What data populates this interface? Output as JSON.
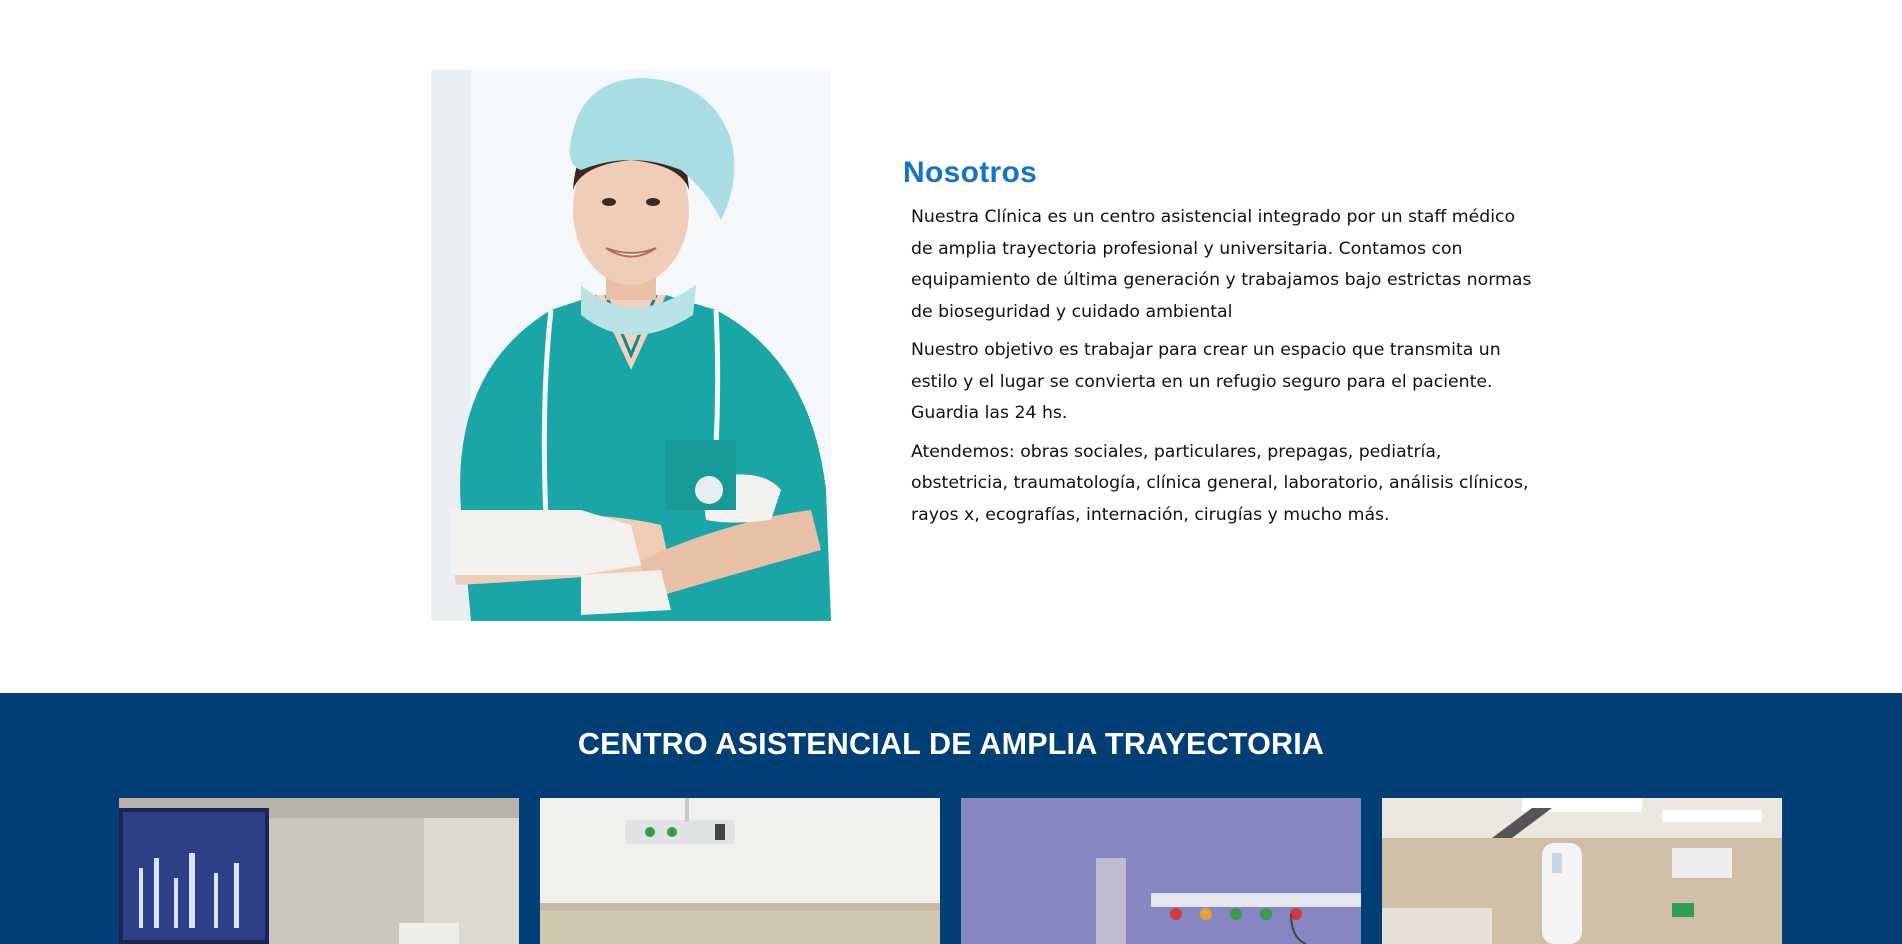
{
  "about": {
    "title": "Nosotros",
    "paragraphs": [
      "Nuestra Clínica es un centro asistencial integrado por un staff médico de amplia trayectoria profesional y universitaria. Contamos con equipamiento de última generación y trabajamos bajo estrictas normas de bioseguridad y cuidado ambiental",
      "Nuestro objetivo es trabajar para crear un espacio que transmita un estilo y el lugar se convierta en un refugio seguro para el paciente. Guardia las 24 hs.",
      "Atendemos: obras sociales, particulares, prepagas, pediatría, obstetricia, traumatología, clínica general, laboratorio, análisis clínicos, rayos x, ecografías, internación, cirugías y mucho más."
    ]
  },
  "services": {
    "title": "CENTRO ASISTENCIAL DE AMPLIA TRAYECTORIA"
  },
  "colors": {
    "accent": "#1673c9",
    "band": "#023f76",
    "scrubs": "#1aa6a6"
  },
  "icons": {
    "photo": "doctor-photo",
    "gallery": [
      "room-photo",
      "ward-photo",
      "oxygen-panel-photo",
      "xray-room-photo"
    ]
  }
}
